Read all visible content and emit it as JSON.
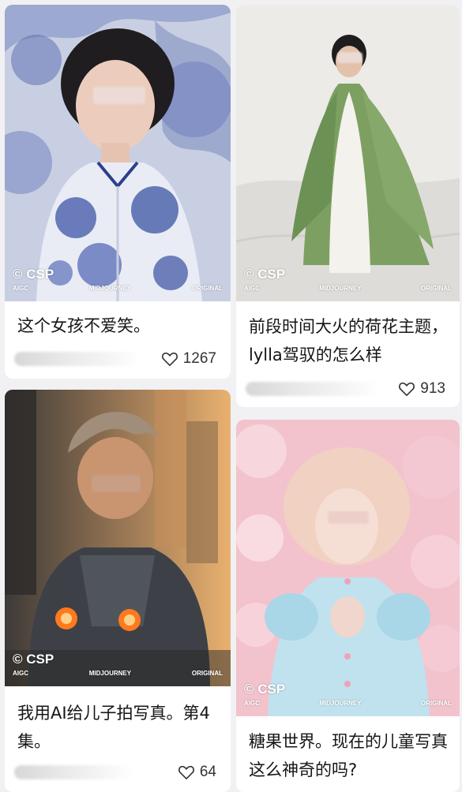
{
  "colors": {
    "background": "#f1f1f3",
    "card": "#ffffff",
    "text": "#151515",
    "like": "#333333"
  },
  "watermark": {
    "logo": "© CSP",
    "aigc": "AIGC",
    "midjourney": "MIDJOURNEY",
    "original": "ORIGINAL"
  },
  "posts": [
    {
      "caption": "这个女孩不爱笑。",
      "likes": "1267",
      "image": "porcelain-dress-girl"
    },
    {
      "caption": "前段时间大火的荷花主题，lylla驾驭的怎么样",
      "likes": "913",
      "image": "green-robe-boy"
    },
    {
      "caption": "我用AI给儿子拍写真。第4集。",
      "likes": "64",
      "image": "robot-armor-boy"
    },
    {
      "caption": "糖果世界。现在的儿童写真这么神奇的吗?",
      "likes": "",
      "image": "candy-world-girl"
    }
  ],
  "icons": {
    "like": "heart-outline-icon"
  }
}
